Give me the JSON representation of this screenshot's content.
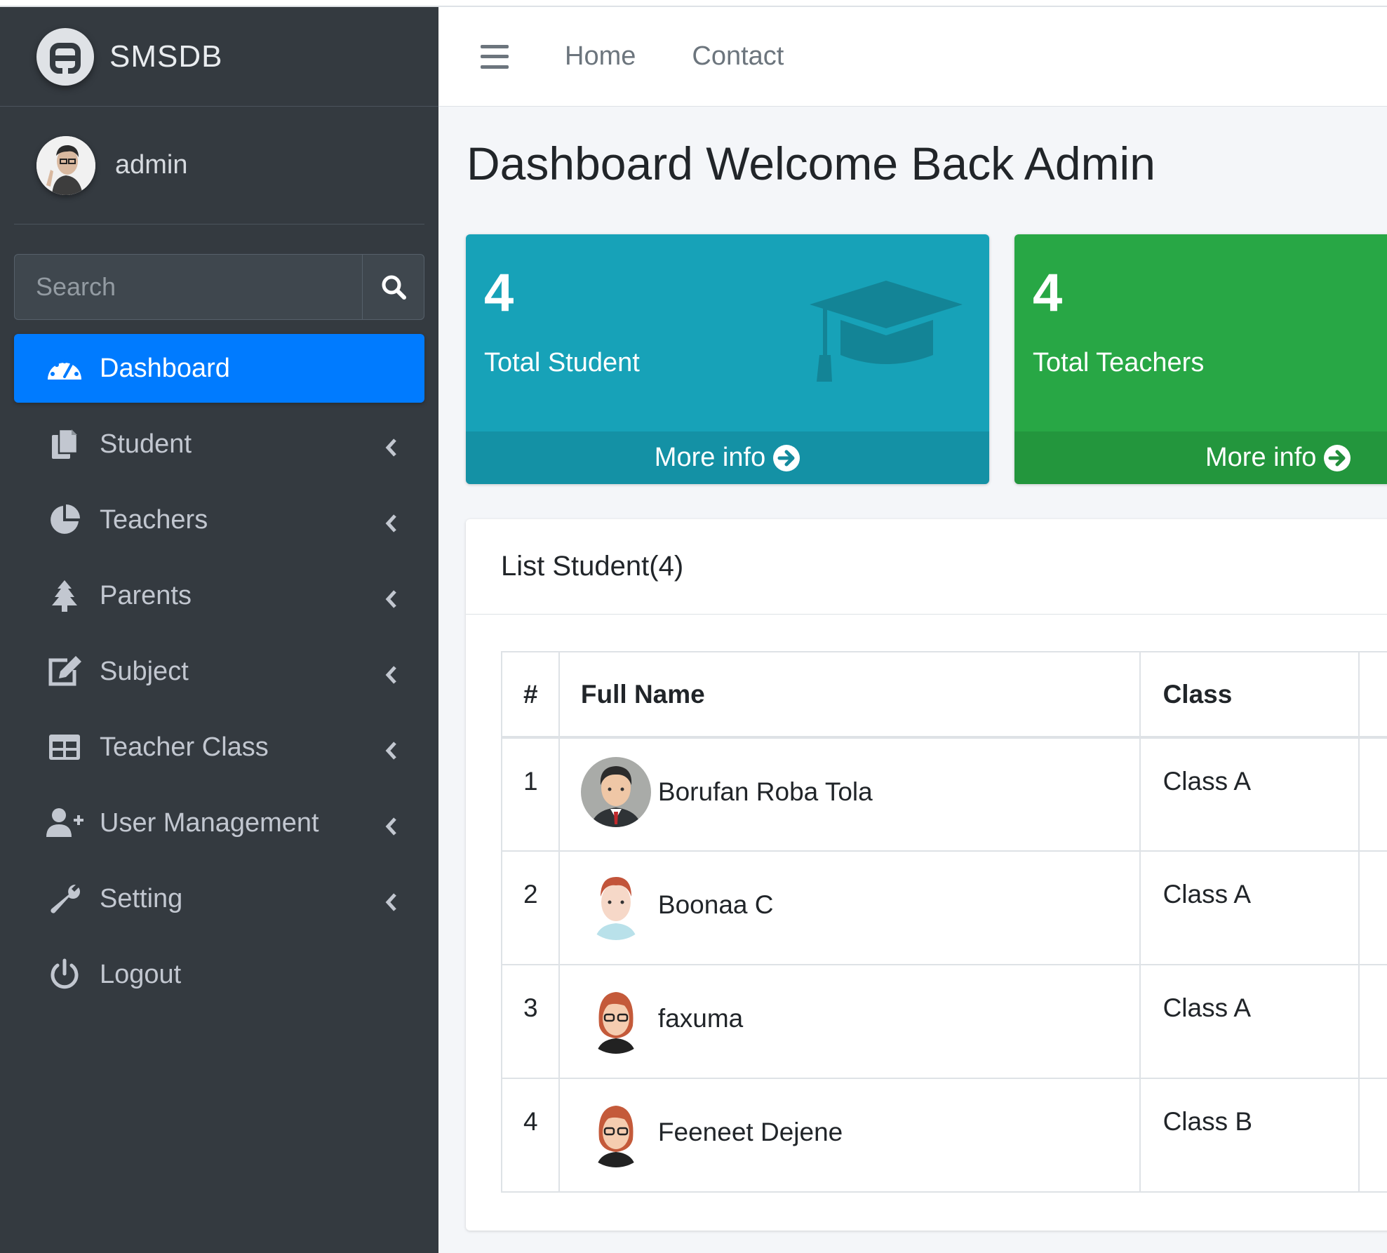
{
  "brand": {
    "name": "SMSDB"
  },
  "user": {
    "name": "admin"
  },
  "search": {
    "placeholder": "Search"
  },
  "nav": [
    {
      "label": "Dashboard",
      "icon": "tachometer-icon",
      "active": true,
      "has_submenu": false
    },
    {
      "label": "Student",
      "icon": "copy-icon",
      "active": false,
      "has_submenu": true
    },
    {
      "label": "Teachers",
      "icon": "chart-pie-icon",
      "active": false,
      "has_submenu": true
    },
    {
      "label": "Parents",
      "icon": "tree-icon",
      "active": false,
      "has_submenu": true
    },
    {
      "label": "Subject",
      "icon": "edit-icon",
      "active": false,
      "has_submenu": true
    },
    {
      "label": "Teacher Class",
      "icon": "table-icon",
      "active": false,
      "has_submenu": true
    },
    {
      "label": "User Management",
      "icon": "user-plus-icon",
      "active": false,
      "has_submenu": true
    },
    {
      "label": "Setting",
      "icon": "wrench-icon",
      "active": false,
      "has_submenu": true
    },
    {
      "label": "Logout",
      "icon": "power-icon",
      "active": false,
      "has_submenu": false
    }
  ],
  "header": {
    "links": [
      "Home",
      "Contact"
    ]
  },
  "page": {
    "title": "Dashboard Welcome Back Admin"
  },
  "stats": [
    {
      "value": "4",
      "label": "Total Student",
      "footer": "More info",
      "color": "#17a2b8",
      "icon": "graduation-cap-icon"
    },
    {
      "value": "4",
      "label": "Total Teachers",
      "footer": "More info",
      "color": "#28a745"
    }
  ],
  "student_list": {
    "title": "List Student(4)",
    "columns": [
      "#",
      "Full Name",
      "Class"
    ],
    "rows": [
      {
        "num": "1",
        "name": "Borufan Roba Tola",
        "class": "Class A"
      },
      {
        "num": "2",
        "name": "Boonaa C",
        "class": "Class A"
      },
      {
        "num": "3",
        "name": "faxuma",
        "class": "Class A"
      },
      {
        "num": "4",
        "name": "Feeneet Dejene",
        "class": "Class B"
      }
    ]
  },
  "colors": {
    "sidebar": "#343a40",
    "primary": "#007bff",
    "info": "#17a2b8",
    "success": "#28a745"
  }
}
